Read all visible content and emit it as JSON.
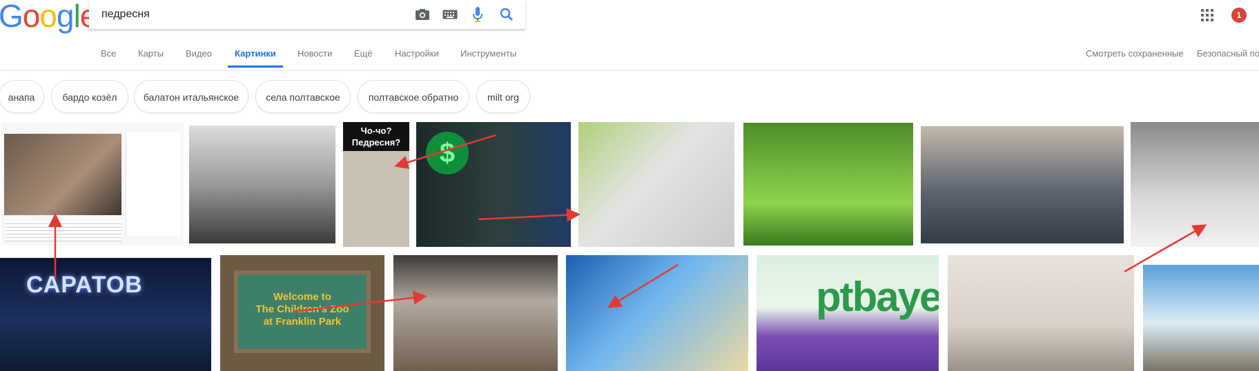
{
  "logo": "Google",
  "search": {
    "query": "педресня"
  },
  "icons": {
    "camera": "camera-icon",
    "keyboard": "keyboard-icon",
    "mic": "mic-icon",
    "search": "search-icon",
    "apps": "apps-grid-icon"
  },
  "notifications": {
    "count": "1"
  },
  "tabs": [
    {
      "label": "Все"
    },
    {
      "label": "Карты"
    },
    {
      "label": "Видео"
    },
    {
      "label": "Картинки",
      "active": true
    },
    {
      "label": "Новости"
    },
    {
      "label": "Ещё"
    },
    {
      "label": "Настройки"
    },
    {
      "label": "Инструменты"
    }
  ],
  "right_links": {
    "saved": "Смотреть сохраненные",
    "safe": "Безопасный пои"
  },
  "chips": [
    "анапа",
    "бардо козёл",
    "балатон итальянское",
    "села полтавское",
    "полтавское обратно",
    "milt org"
  ],
  "image_texts": {
    "choco_line1": "Чо-чо?",
    "choco_line2": "Педресня?",
    "saratov": "САРАТОВ",
    "welcome1": "Welcome to",
    "welcome2": "The Children's Zoo",
    "welcome3": "at Franklin Park",
    "ptbayer": "ptbaye"
  },
  "colors": {
    "accent": "#1a73e8",
    "arrow": "#e53935",
    "notif": "#db4437"
  }
}
